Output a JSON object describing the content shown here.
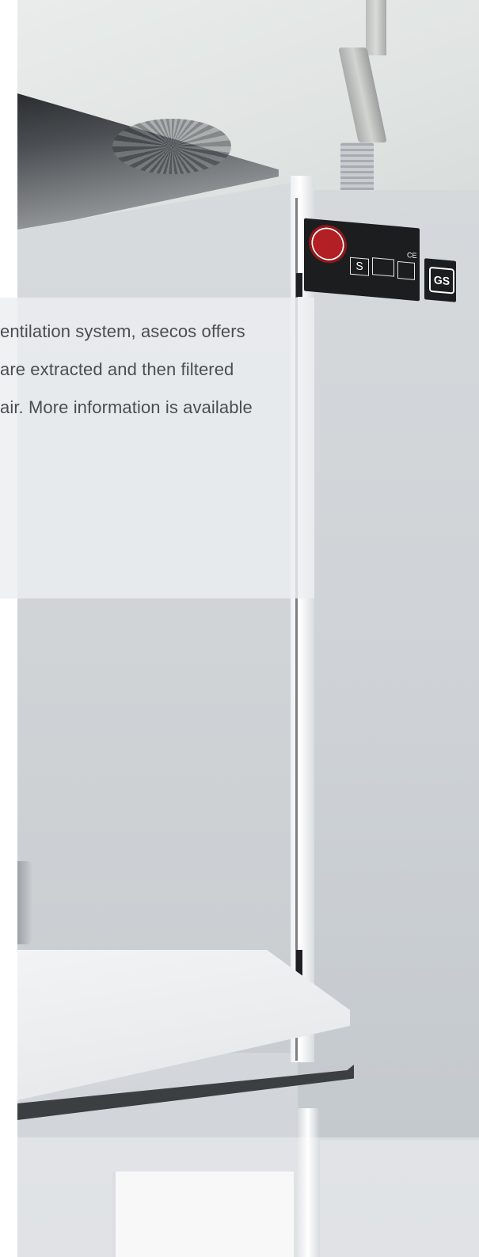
{
  "panel": {
    "lines": [
      "entilation system, asecos offers",
      "are extracted and then filtered",
      "air. More information is available"
    ]
  },
  "cabinet": {
    "label_s": "S",
    "label_ce": "CE",
    "gs_mark": "GS"
  },
  "colors": {
    "panel_text": "#4a4d52",
    "seal_red": "#b21f24",
    "plate_black": "#1b1d1f"
  }
}
